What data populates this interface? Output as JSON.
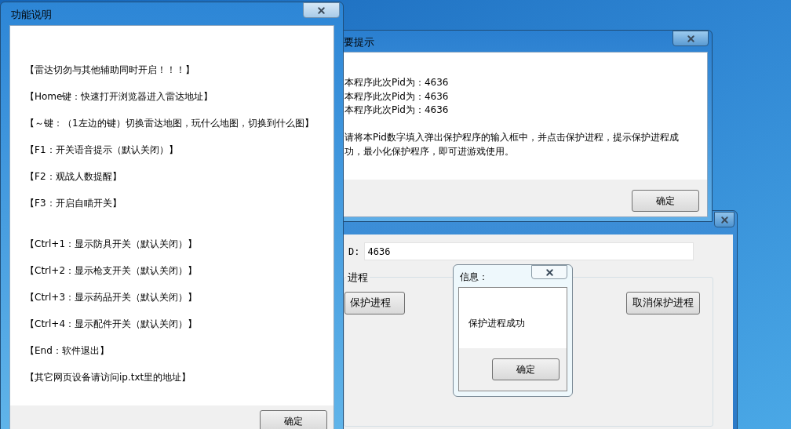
{
  "help_window": {
    "title": "功能说明",
    "sections": [
      [
        "【雷达切勿与其他辅助同时开启！！！】",
        "【Home键：快速打开浏览器进入雷达地址】",
        "【～键：（1左边的键）切换雷达地图，玩什么地图，切换到什么图】",
        "【F1：开关语音提示（默认关闭）】",
        "【F2：观战人数提醒】",
        "【F3：开启自瞄开关】"
      ],
      [
        "【Ctrl+1：显示防具开关（默认关闭）】",
        "【Ctrl+2：显示枪支开关（默认关闭）】",
        "【Ctrl+3：显示药品开关（默认关闭）】",
        "【Ctrl+4：显示配件开关（默认关闭）】",
        "【End：软件退出】",
        "【其它网页设备请访问ip.txt里的地址】"
      ]
    ],
    "button": "确定"
  },
  "notice_window": {
    "title": "要提示",
    "pid_lines": [
      "本程序此次Pid为：4636",
      "本程序此次Pid为：4636",
      "本程序此次Pid为：4636"
    ],
    "instruction": "请将本Pid数字填入弹出保护程序的输入框中，并点击保护进程，提示保护进程成功，最小化保护程序，即可进游戏使用。",
    "button": "确定"
  },
  "protect_window": {
    "pid_label": "D:",
    "pid_value": "4636",
    "group_label": "进程",
    "buttons": [
      "保护进程",
      "取消保护进程"
    ]
  },
  "message_dialog": {
    "title": "信息：",
    "message": "保护进程成功",
    "button": "确定"
  }
}
